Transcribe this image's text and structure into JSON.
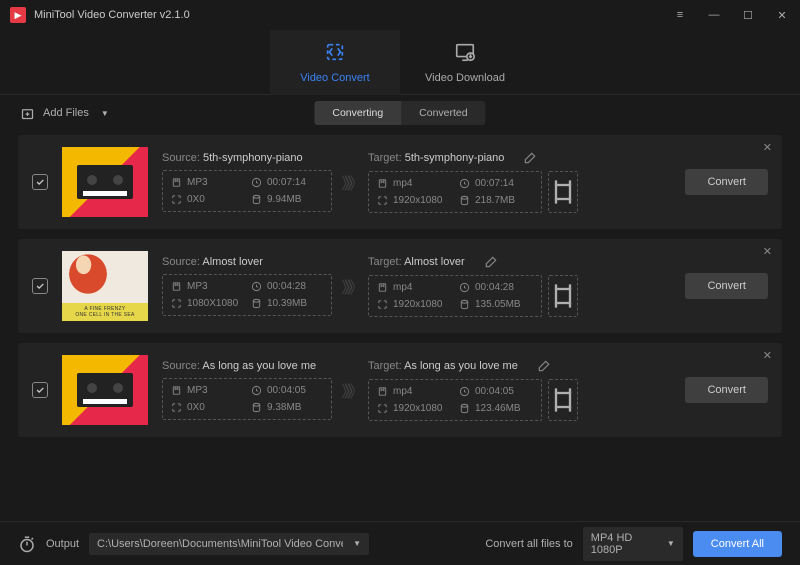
{
  "app": {
    "title": "MiniTool Video Converter v2.1.0"
  },
  "topnav": {
    "convert": "Video Convert",
    "download": "Video Download"
  },
  "toolbar": {
    "add_files": "Add Files",
    "tab_converting": "Converting",
    "tab_converted": "Converted"
  },
  "labels": {
    "source": "Source:",
    "target": "Target:",
    "convert": "Convert"
  },
  "items": [
    {
      "thumb": "cassette",
      "source": {
        "name": "5th-symphony-piano",
        "format": "MP3",
        "duration": "00:07:14",
        "res": "0X0",
        "size": "9.94MB"
      },
      "target": {
        "name": "5th-symphony-piano",
        "format": "mp4",
        "duration": "00:07:14",
        "res": "1920x1080",
        "size": "218.7MB"
      }
    },
    {
      "thumb": "fine",
      "fine_text1": "A FINE FRENZY",
      "fine_text2": "ONE CELL IN THE SEA",
      "source": {
        "name": "Almost lover",
        "format": "MP3",
        "duration": "00:04:28",
        "res": "1080X1080",
        "size": "10.39MB"
      },
      "target": {
        "name": "Almost lover",
        "format": "mp4",
        "duration": "00:04:28",
        "res": "1920x1080",
        "size": "135.05MB"
      }
    },
    {
      "thumb": "cassette",
      "source": {
        "name": "As long as you love me",
        "format": "MP3",
        "duration": "00:04:05",
        "res": "0X0",
        "size": "9.38MB"
      },
      "target": {
        "name": "As long as you love me",
        "format": "mp4",
        "duration": "00:04:05",
        "res": "1920x1080",
        "size": "123.46MB"
      }
    }
  ],
  "footer": {
    "output_label": "Output",
    "path": "C:\\Users\\Doreen\\Documents\\MiniTool Video Converter\\outpu",
    "convert_all_to": "Convert all files to",
    "profile": "MP4 HD 1080P",
    "convert_all": "Convert All"
  }
}
